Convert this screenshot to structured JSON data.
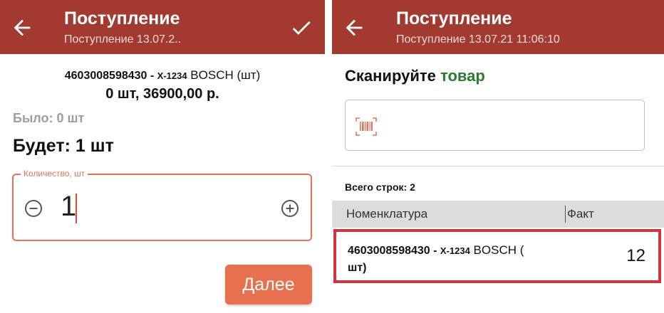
{
  "left_screen": {
    "header": {
      "title": "Поступление",
      "subtitle": "Поступление 13.07.2.."
    },
    "product": {
      "code": "4603008598430",
      "separator": " - ",
      "model": "X-1234",
      "brand": " BOSCH (шт)",
      "price_line": "0 шт, 36900,00 р."
    },
    "was_label": "Было: 0 шт",
    "will_label": "Будет: 1 шт",
    "quantity": {
      "label": "Количество, шт",
      "value": "1"
    },
    "next_button": "Далее"
  },
  "right_screen": {
    "header": {
      "title": "Поступление",
      "subtitle": "Поступление 13.07.21 11:06:10"
    },
    "scan_prompt": {
      "text": "Сканируйте ",
      "accent": "товар"
    },
    "total_rows": "Всего строк: 2",
    "table": {
      "columns": [
        "Номенклатура",
        "Факт"
      ],
      "rows": [
        {
          "code": "4603008598430",
          "separator": " - ",
          "model": "X-1234",
          "brand": " BOSCH (",
          "unit": "шт)",
          "fact": "12"
        }
      ]
    }
  },
  "colors": {
    "header_bg": "#a23a2f",
    "accent_orange": "#e8704f",
    "accent_green": "#2a7d2e",
    "highlight_red": "#d0353b"
  },
  "icons": [
    "arrow-left-icon",
    "check-icon",
    "minus-circle-icon",
    "plus-circle-icon",
    "barcode-icon"
  ]
}
